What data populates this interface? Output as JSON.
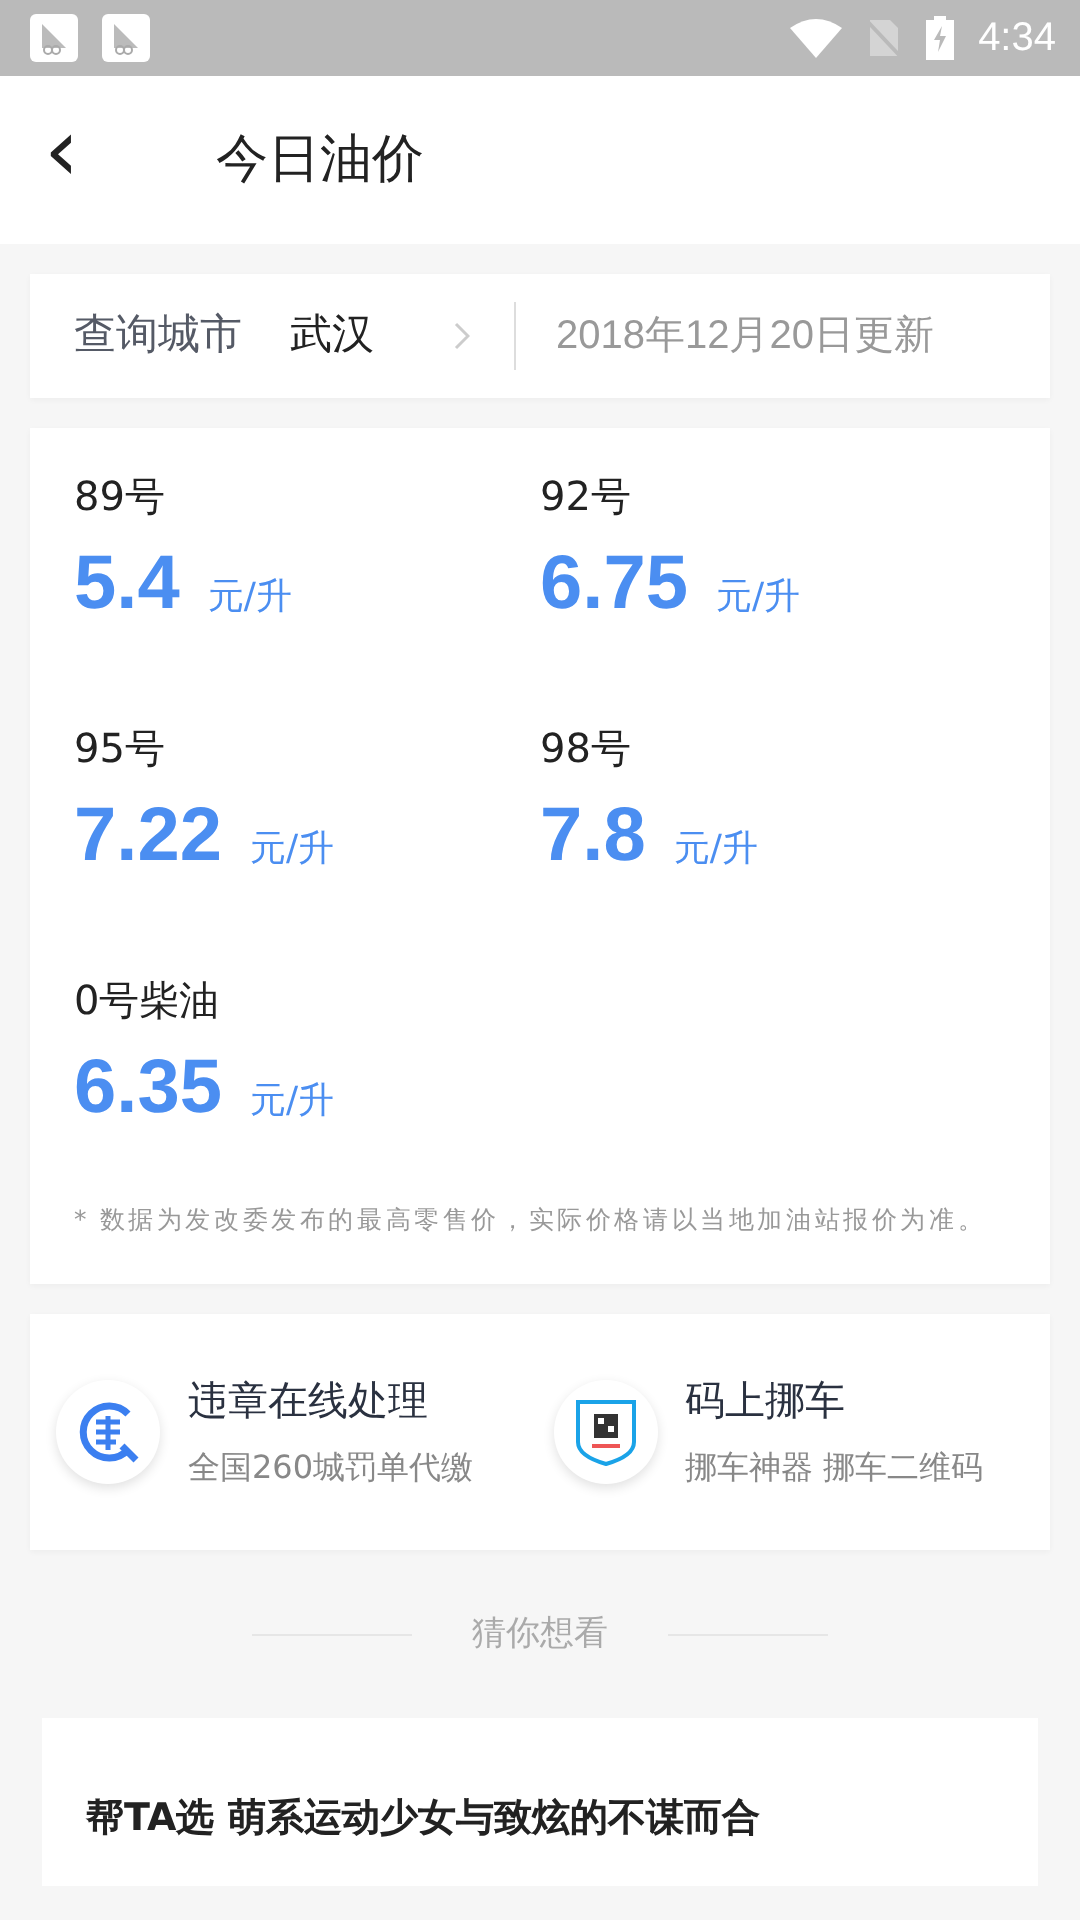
{
  "status_bar": {
    "time": "4:34"
  },
  "header": {
    "back_icon": "‹",
    "title": "今日油价"
  },
  "city_bar": {
    "label": "查询城市",
    "city": "武汉",
    "updated": "2018年12月20日更新"
  },
  "prices": [
    {
      "grade": "89号",
      "price": "5.4",
      "unit": "元/升"
    },
    {
      "grade": "92号",
      "price": "6.75",
      "unit": "元/升"
    },
    {
      "grade": "95号",
      "price": "7.22",
      "unit": "元/升"
    },
    {
      "grade": "98号",
      "price": "7.8",
      "unit": "元/升"
    },
    {
      "grade": "0号柴油",
      "price": "6.35",
      "unit": "元/升"
    }
  ],
  "note": "* 数据为发改委发布的最高零售价，实际价格请以当地加油站报价为准。",
  "services": [
    {
      "kind": "violation",
      "title": "违章在线处理",
      "subtitle": "全国260城罚单代缴"
    },
    {
      "kind": "qrcode",
      "title": "码上挪车",
      "subtitle": "挪车神器 挪车二维码"
    }
  ],
  "recommend": {
    "heading": "猜你想看",
    "articles": [
      {
        "title": "帮TA选 萌系运动少女与致炫的不谋而合"
      }
    ]
  }
}
